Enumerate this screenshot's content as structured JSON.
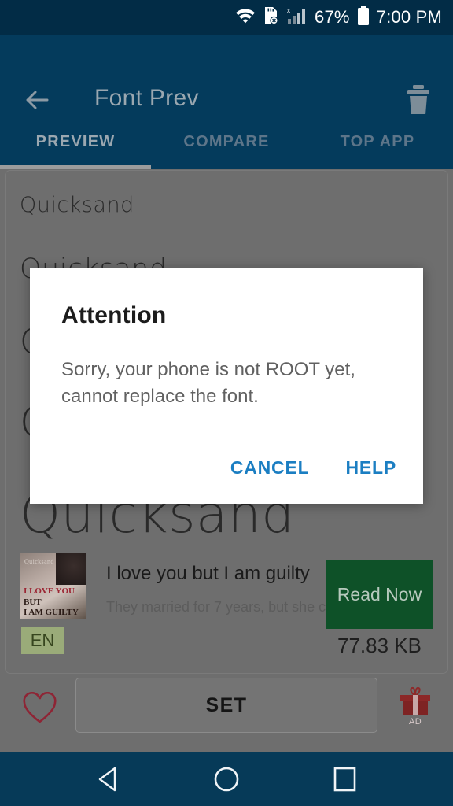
{
  "status_bar": {
    "battery_percent": "67%",
    "time": "7:00 PM",
    "icons": [
      "wifi-icon",
      "sd-card-error-icon",
      "signal-bars-icon",
      "battery-icon"
    ]
  },
  "app_bar": {
    "title": "Font Prev",
    "back_icon": "arrow-left-icon",
    "delete_icon": "trash-icon"
  },
  "tabs": [
    {
      "label": "PREVIEW",
      "selected": true
    },
    {
      "label": "COMPARE",
      "selected": false
    },
    {
      "label": "TOP APP",
      "selected": false
    }
  ],
  "preview": {
    "font_name": "Quicksand",
    "samples": [
      "Quicksand",
      "Quicksand",
      "Quicksand",
      "Quicksand",
      "Quicksand"
    ]
  },
  "ad": {
    "title": "I love you but I am guilty",
    "description": "They married for 7 years, but she c…",
    "button_label": "Read Now",
    "size": "77.83 KB",
    "language_badge": "EN",
    "thumb_text": {
      "line1": "Quicksand",
      "line2": "I LOVE YOU",
      "line3": "BUT",
      "line4": "I AM GUILTY"
    }
  },
  "action_bar": {
    "favorite_icon": "heart-icon",
    "set_label": "SET",
    "gift_icon": "gift-icon",
    "gift_ad_label": "AD"
  },
  "dialog": {
    "title": "Attention",
    "message": "Sorry, your phone is not ROOT yet, cannot replace the font.",
    "cancel_label": "CANCEL",
    "help_label": "HELP",
    "accent_color": "#1b7ec2"
  },
  "nav_bar": {
    "back_icon": "triangle-back-icon",
    "home_icon": "circle-home-icon",
    "recents_icon": "square-recents-icon"
  },
  "colors": {
    "status_bar": "#022c46",
    "app_bar": "#043b5c",
    "nav_bar": "#063a58",
    "dim_overlay": "#6e6e6e",
    "read_now_green": "#0e5128",
    "lang_badge_green": "#9aab79",
    "dialog_accent": "#1b7ec2"
  }
}
